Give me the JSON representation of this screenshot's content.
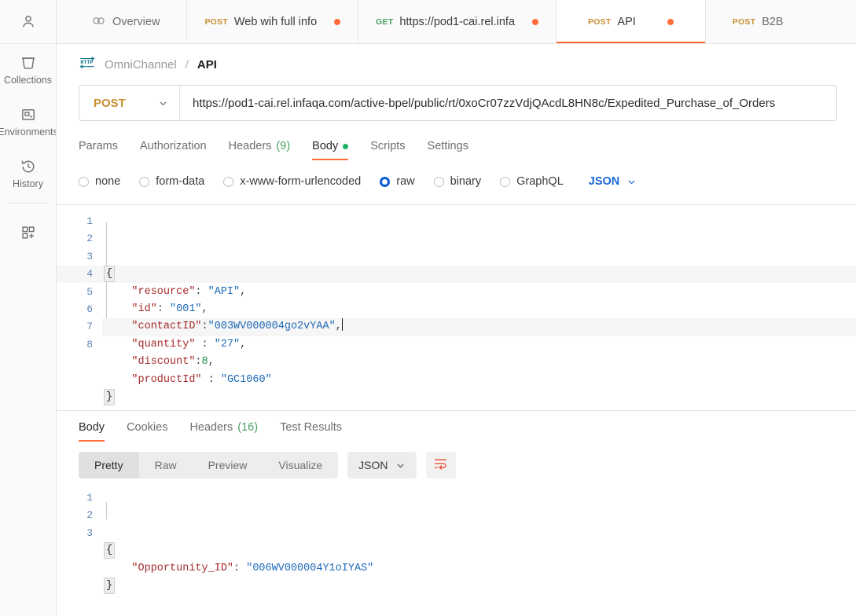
{
  "sidebar": {
    "account_icon": "person-icon",
    "items": [
      {
        "label": "Collections",
        "icon": "collections-icon"
      },
      {
        "label": "Environments",
        "icon": "environments-icon"
      },
      {
        "label": "History",
        "icon": "history-icon"
      }
    ],
    "apps_icon": "add-apps-icon"
  },
  "tabstrip": {
    "tabs": [
      {
        "kind": "overview",
        "icon": "overview-icon",
        "label": "Overview",
        "method": "",
        "dirty": false,
        "active": false
      },
      {
        "kind": "request",
        "icon": "",
        "label": "Web wih full info",
        "method": "POST",
        "dirty": true,
        "active": false
      },
      {
        "kind": "request",
        "icon": "",
        "label": "https://pod1-cai.rel.infa",
        "method": "GET",
        "dirty": true,
        "active": false
      },
      {
        "kind": "request",
        "icon": "",
        "label": "API",
        "method": "POST",
        "dirty": true,
        "active": true
      },
      {
        "kind": "request",
        "icon": "",
        "label": "B2B",
        "method": "POST",
        "dirty": false,
        "active": false
      }
    ]
  },
  "breadcrumb": {
    "icon": "http-protocol-icon",
    "collection": "OmniChannel",
    "separator": "/",
    "current": "API"
  },
  "request": {
    "method": "POST",
    "method_chevron": "chevron-down-icon",
    "url": "https://pod1-cai.rel.infaqa.com/active-bpel/public/rt/0xoCr07zzVdjQAcdL8HN8c/Expedited_Purchase_of_Orders",
    "tabs": [
      {
        "label": "Params",
        "count": "",
        "dot": false,
        "active": false
      },
      {
        "label": "Authorization",
        "count": "",
        "dot": false,
        "active": false
      },
      {
        "label": "Headers",
        "count": "(9)",
        "dot": false,
        "active": false
      },
      {
        "label": "Body",
        "count": "",
        "dot": true,
        "active": true
      },
      {
        "label": "Scripts",
        "count": "",
        "dot": false,
        "active": false
      },
      {
        "label": "Settings",
        "count": "",
        "dot": false,
        "active": false
      }
    ],
    "body_types": [
      {
        "label": "none",
        "selected": false
      },
      {
        "label": "form-data",
        "selected": false
      },
      {
        "label": "x-www-form-urlencoded",
        "selected": false
      },
      {
        "label": "raw",
        "selected": true
      },
      {
        "label": "binary",
        "selected": false
      },
      {
        "label": "GraphQL",
        "selected": false
      }
    ],
    "raw_format": "JSON",
    "raw_format_chevron": "chevron-down-icon",
    "body_lines": [
      {
        "no": "1",
        "tokens": [
          {
            "t": "brace",
            "v": "{"
          }
        ]
      },
      {
        "no": "2",
        "tokens": [
          {
            "t": "p",
            "v": "    "
          },
          {
            "t": "k",
            "v": "\"resource\""
          },
          {
            "t": "p",
            "v": ": "
          },
          {
            "t": "s",
            "v": "\"API\""
          },
          {
            "t": "p",
            "v": ","
          }
        ]
      },
      {
        "no": "3",
        "tokens": [
          {
            "t": "p",
            "v": "    "
          },
          {
            "t": "k",
            "v": "\"id\""
          },
          {
            "t": "p",
            "v": ": "
          },
          {
            "t": "s",
            "v": "\"001\""
          },
          {
            "t": "p",
            "v": ","
          }
        ]
      },
      {
        "no": "4",
        "tokens": [
          {
            "t": "p",
            "v": "    "
          },
          {
            "t": "k",
            "v": "\"contactID\""
          },
          {
            "t": "p",
            "v": ":"
          },
          {
            "t": "s",
            "v": "\"003WV000004go2vYAA\""
          },
          {
            "t": "p",
            "v": ","
          },
          {
            "t": "caret",
            "v": ""
          }
        ]
      },
      {
        "no": "5",
        "tokens": [
          {
            "t": "p",
            "v": "    "
          },
          {
            "t": "k",
            "v": "\"quantity\""
          },
          {
            "t": "p",
            "v": " : "
          },
          {
            "t": "s",
            "v": "\"27\""
          },
          {
            "t": "p",
            "v": ","
          }
        ]
      },
      {
        "no": "6",
        "tokens": [
          {
            "t": "p",
            "v": "    "
          },
          {
            "t": "k",
            "v": "\"discount\""
          },
          {
            "t": "p",
            "v": ":"
          },
          {
            "t": "n",
            "v": "8"
          },
          {
            "t": "p",
            "v": ","
          }
        ]
      },
      {
        "no": "7",
        "tokens": [
          {
            "t": "p",
            "v": "    "
          },
          {
            "t": "k",
            "v": "\"productId\""
          },
          {
            "t": "p",
            "v": " : "
          },
          {
            "t": "s",
            "v": "\"GC1060\""
          }
        ]
      },
      {
        "no": "8",
        "tokens": [
          {
            "t": "brace",
            "v": "}"
          }
        ]
      }
    ]
  },
  "response": {
    "tabs": [
      {
        "label": "Body",
        "count": "",
        "active": true
      },
      {
        "label": "Cookies",
        "count": "",
        "active": false
      },
      {
        "label": "Headers",
        "count": "(16)",
        "active": false
      },
      {
        "label": "Test Results",
        "count": "",
        "active": false
      }
    ],
    "views": [
      {
        "label": "Pretty",
        "active": true
      },
      {
        "label": "Raw",
        "active": false
      },
      {
        "label": "Preview",
        "active": false
      },
      {
        "label": "Visualize",
        "active": false
      }
    ],
    "format": "JSON",
    "format_chevron": "chevron-down-icon",
    "wrap_icon": "word-wrap-icon",
    "body_lines": [
      {
        "no": "1",
        "tokens": [
          {
            "t": "brace",
            "v": "{"
          }
        ]
      },
      {
        "no": "2",
        "tokens": [
          {
            "t": "p",
            "v": "    "
          },
          {
            "t": "k",
            "v": "\"Opportunity_ID\""
          },
          {
            "t": "p",
            "v": ": "
          },
          {
            "t": "s",
            "v": "\"006WV000004Y1oIYAS\""
          }
        ]
      },
      {
        "no": "3",
        "tokens": [
          {
            "t": "brace",
            "v": "}"
          }
        ]
      }
    ]
  },
  "colors": {
    "accent_orange": "#ff6c37",
    "method_post": "#c89031",
    "method_get": "#4aa163",
    "selected_radio": "#0b5cd5",
    "json_label": "#1667d6",
    "dirty_dot": "#ff6c37",
    "body_dot": "#1bb35f",
    "http_icon": "#0b7285"
  }
}
